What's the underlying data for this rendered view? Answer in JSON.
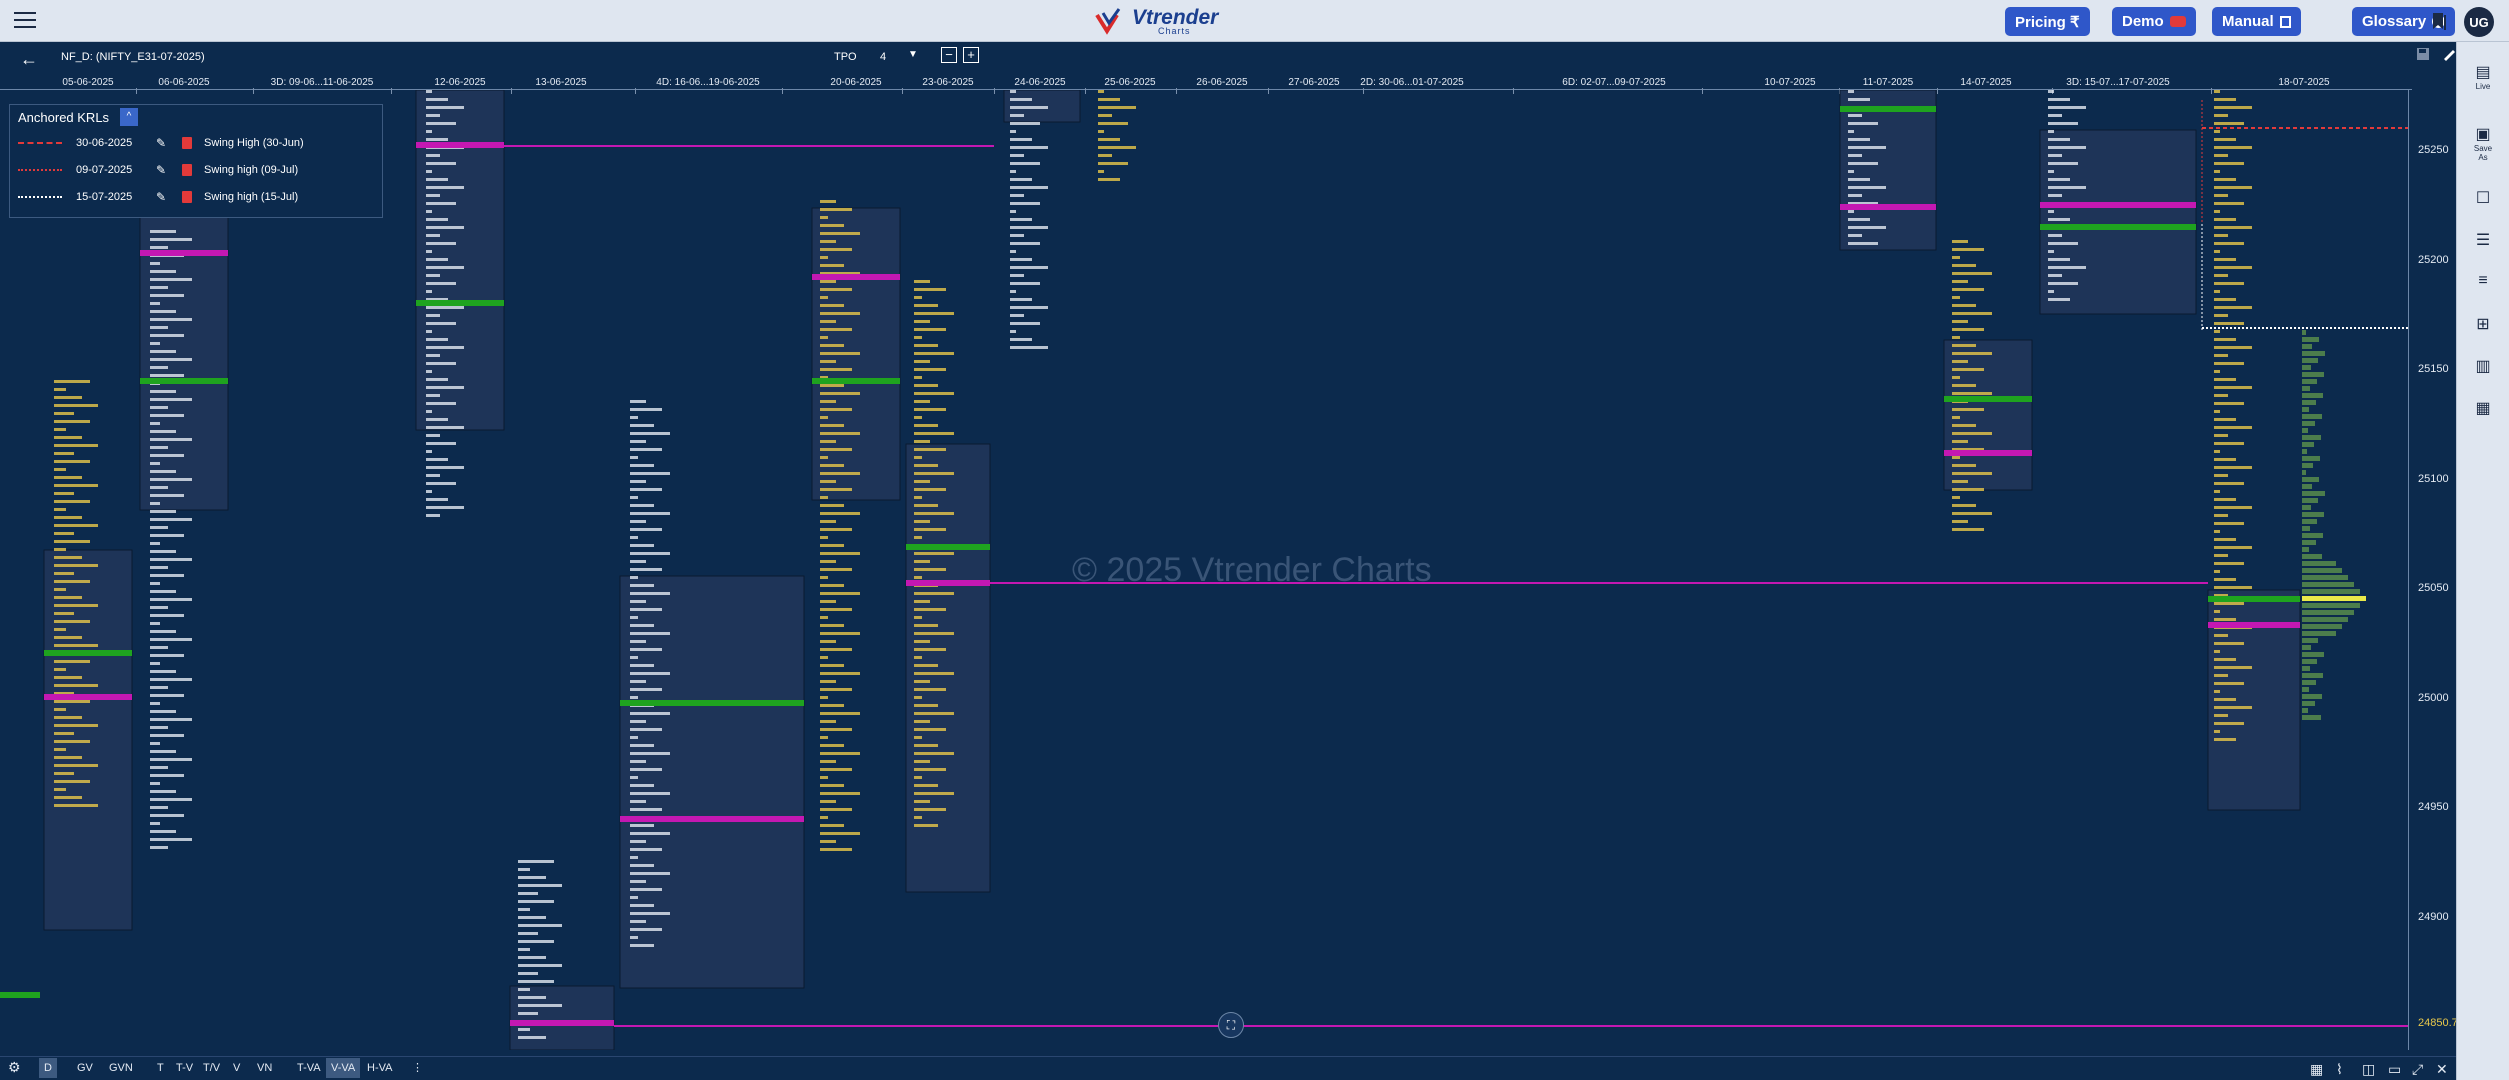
{
  "app": {
    "logo_text": "Vtrender",
    "logo_sub": "Charts",
    "buttons": {
      "pricing": "Pricing ₹",
      "demo": "Demo",
      "manual": "Manual",
      "glossary": "Glossary"
    },
    "avatar": "UG"
  },
  "subbar": {
    "symbol": "NF_D: (NIFTY_E31-07-2025)",
    "tpo_label": "TPO",
    "tpo_value": "4",
    "minus": "−",
    "plus": "+"
  },
  "dates": [
    "05-06-2025",
    "06-06-2025",
    "3D: 09-06...11-06-2025",
    "12-06-2025",
    "13-06-2025",
    "4D: 16-06...19-06-2025",
    "20-06-2025",
    "23-06-2025",
    "24-06-2025",
    "25-06-2025",
    "26-06-2025",
    "27-06-2025",
    "2D: 30-06...01-07-2025",
    "6D: 02-07...09-07-2025",
    "10-07-2025",
    "11-07-2025",
    "14-07-2025",
    "3D: 15-07...17-07-2025",
    "18-07-2025"
  ],
  "krl": {
    "title": "Anchored KRLs",
    "collapse": "^",
    "rows": [
      {
        "date": "30-06-2025",
        "name": "Swing High (30-Jun)",
        "color": "#e23a3a"
      },
      {
        "date": "09-07-2025",
        "name": "Swing high (09-Jul)",
        "color": "#e23a3a"
      },
      {
        "date": "15-07-2025",
        "name": "Swing high (15-Jul)",
        "color": "#ffffff"
      }
    ]
  },
  "watermark": "© 2025 Vtrender Charts",
  "price_axis": [
    "25250",
    "25200",
    "25150",
    "25100",
    "25050",
    "25000",
    "24950",
    "24900"
  ],
  "price_marker": "24850.70",
  "right_sidebar": {
    "live": "Live",
    "save_as": "Save As"
  },
  "bottom_bar": {
    "items": [
      "D",
      "GV",
      "GVN",
      "T",
      "T-V",
      "T/V",
      "V",
      "VN",
      "T-VA",
      "V-VA",
      "H-VA"
    ],
    "active": [
      "D",
      "V-VA"
    ]
  },
  "colors": {
    "background": "#0c2a4d",
    "profile_box": "#1e3458",
    "poc": "#c418b2",
    "va_green": "#1fa31f",
    "tpo_yellow": "#e9c84a",
    "tpo_white": "#e4eaf3"
  }
}
